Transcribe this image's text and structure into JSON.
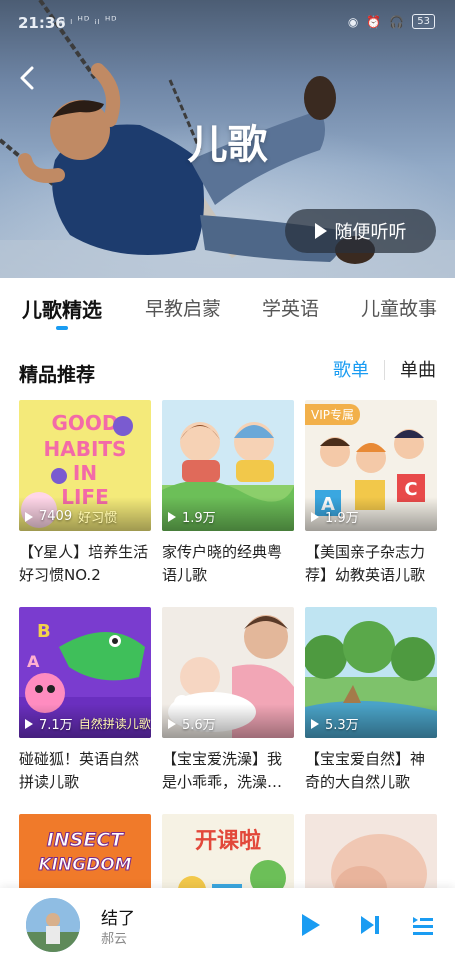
{
  "status_bar": {
    "time": "21:36",
    "signal": "ᵢₗ ₗ ᴴᴰ ᵢₗ ᴴᴰ",
    "battery": "53"
  },
  "hero": {
    "title": "儿歌",
    "random_play_label": "随便听听"
  },
  "tabs": [
    {
      "label": "儿歌精选",
      "active": true
    },
    {
      "label": "早教启蒙",
      "active": false
    },
    {
      "label": "学英语",
      "active": false
    },
    {
      "label": "儿童故事",
      "active": false
    }
  ],
  "section": {
    "title": "精品推荐",
    "toggle_playlist": "歌单",
    "toggle_song": "单曲"
  },
  "cards": [
    {
      "title": "【Y星人】培养生活好习惯NO.2",
      "plays": "7409",
      "cover_text": "GOOD HABITS IN LIFE",
      "cover_caption": "好习惯",
      "vip": ""
    },
    {
      "title": "家传户晓的经典粤语儿歌",
      "plays": "1.9万",
      "cover_text": "",
      "cover_caption": "",
      "vip": ""
    },
    {
      "title": "【美国亲子杂志力荐】幼教英语儿歌",
      "plays": "1.9万",
      "cover_text": "",
      "cover_caption": "",
      "vip": "VIP专属"
    },
    {
      "title": "碰碰狐！英语自然拼读儿歌",
      "plays": "7.1万",
      "cover_text": "",
      "cover_caption": "自然拼读儿歌",
      "vip": ""
    },
    {
      "title": "【宝宝爱洗澡】我是小乖乖，洗澡…",
      "plays": "5.6万",
      "cover_text": "",
      "cover_caption": "",
      "vip": ""
    },
    {
      "title": "【宝宝爱自然】神奇的大自然儿歌",
      "plays": "5.3万",
      "cover_text": "",
      "cover_caption": "",
      "vip": ""
    },
    {
      "title": "",
      "plays": "",
      "cover_text": "INSECT KINGDOM",
      "cover_caption": "",
      "vip": ""
    },
    {
      "title": "",
      "plays": "",
      "cover_text": "开课啦",
      "cover_caption": "",
      "vip": ""
    },
    {
      "title": "",
      "plays": "",
      "cover_text": "",
      "cover_caption": "",
      "vip": ""
    }
  ],
  "player": {
    "song": "结了",
    "artist": "郝云"
  },
  "colors": {
    "accent": "#1a9cf2",
    "vip": "#f2b04a"
  }
}
